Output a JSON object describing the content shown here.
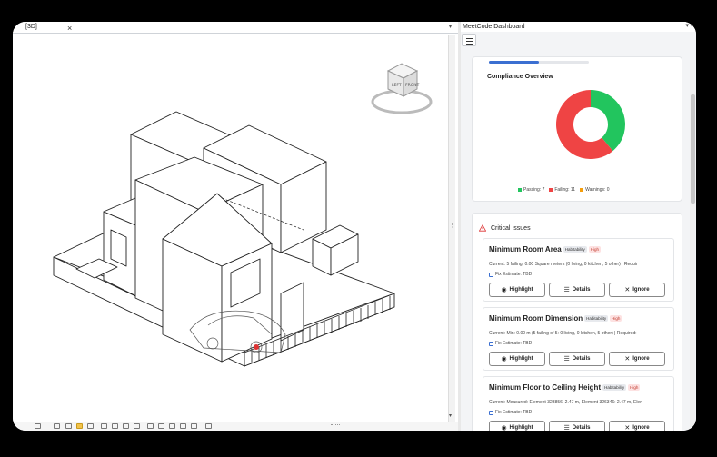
{
  "viewport": {
    "tab_label": "[3D]",
    "close_glyph": "×",
    "viewcube_left": "LEFT",
    "viewcube_front": "FRONT"
  },
  "panel": {
    "title": "MeetCode Dashboard",
    "controls": "▾ ×"
  },
  "overview": {
    "progress": 0.5,
    "title": "Compliance Overview",
    "passing_label": "Passing: 7",
    "failing_label": "Failing: 11",
    "warnings_label": "Warnings: 0",
    "passing": 7,
    "failing": 11,
    "warnings": 0,
    "colors": {
      "passing": "#22c55e",
      "failing": "#ef4444",
      "warnings": "#f59e0b"
    }
  },
  "critical": {
    "heading": "Critical Issues",
    "issues": [
      {
        "title": "Minimum Room Area",
        "category": "Habitability",
        "severity": "High",
        "current": "Current: 5 failing: 0.00 Square meters (0 living, 0 kitchen, 5 other) | Requir",
        "fix": "Fix Estimate: TBD"
      },
      {
        "title": "Minimum Room Dimension",
        "category": "Habitability",
        "severity": "High",
        "current": "Current: Min: 0.00 m (5 failing of 5: 0 living, 0 kitchen, 5 other) | Required:",
        "fix": "Fix Estimate: TBD"
      },
      {
        "title": "Minimum Floor to Ceiling Height",
        "category": "Habitability",
        "severity": "High",
        "current": "Current: Measured: Element 323856: 2.47 m, Element 326346: 2.47 m, Elen",
        "fix": "Fix Estimate: TBD"
      }
    ],
    "buttons": {
      "highlight": "Highlight",
      "details": "Details",
      "ignore": "Ignore"
    }
  }
}
